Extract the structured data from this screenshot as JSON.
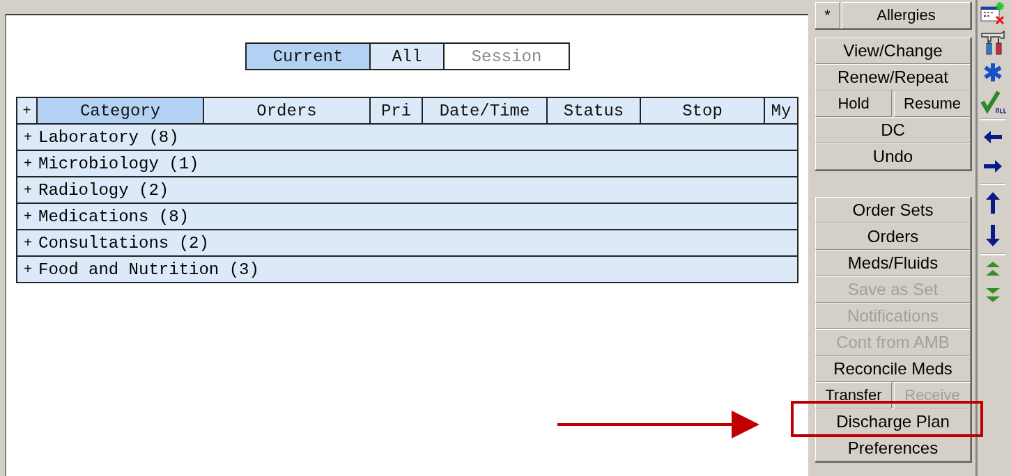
{
  "filter_tabs": [
    {
      "label": "Current",
      "selected": true,
      "disabled": false
    },
    {
      "label": "All",
      "selected": false,
      "disabled": false
    },
    {
      "label": "Session",
      "selected": false,
      "disabled": true
    }
  ],
  "table": {
    "expand_all": "+",
    "columns": [
      {
        "label": "Category",
        "selected": true
      },
      {
        "label": "Orders",
        "selected": false
      },
      {
        "label": "Pri",
        "selected": false
      },
      {
        "label": "Date/Time",
        "selected": false
      },
      {
        "label": "Status",
        "selected": false
      },
      {
        "label": "Stop",
        "selected": false
      },
      {
        "label": "My",
        "selected": false
      }
    ],
    "rows": [
      {
        "toggle": "+",
        "label": "Laboratory (8)"
      },
      {
        "toggle": "+",
        "label": "Microbiology (1)"
      },
      {
        "toggle": "+",
        "label": "Radiology (2)"
      },
      {
        "toggle": "+",
        "label": "Medications (8)"
      },
      {
        "toggle": "+",
        "label": "Consultations (2)"
      },
      {
        "toggle": "+",
        "label": "Food and Nutrition (3)"
      }
    ]
  },
  "action_panel": {
    "groups": [
      [
        [
          {
            "label": "*",
            "disabled": false
          },
          {
            "label": "Allergies",
            "disabled": false
          }
        ]
      ],
      [
        [
          {
            "label": "View/Change",
            "disabled": false
          }
        ],
        [
          {
            "label": "Renew/Repeat",
            "disabled": false
          }
        ],
        [
          {
            "label": "Hold",
            "disabled": false
          },
          {
            "label": "Resume",
            "disabled": false
          }
        ],
        [
          {
            "label": "DC",
            "disabled": false
          }
        ],
        [
          {
            "label": "Undo",
            "disabled": false
          }
        ]
      ],
      [
        [
          {
            "label": "Order Sets",
            "disabled": false
          }
        ],
        [
          {
            "label": "Orders",
            "disabled": false
          }
        ],
        [
          {
            "label": "Meds/Fluids",
            "disabled": false
          }
        ],
        [
          {
            "label": "Save as Set",
            "disabled": true
          }
        ],
        [
          {
            "label": "Notifications",
            "disabled": true
          }
        ],
        [
          {
            "label": "Cont from AMB",
            "disabled": true
          }
        ],
        [
          {
            "label": "Reconcile Meds",
            "disabled": false
          }
        ],
        [
          {
            "label": "Transfer",
            "disabled": false
          },
          {
            "label": "Receive",
            "disabled": true
          }
        ],
        [
          {
            "label": "Discharge Plan",
            "disabled": false
          }
        ],
        [
          {
            "label": "Preferences",
            "disabled": false
          }
        ]
      ]
    ]
  }
}
